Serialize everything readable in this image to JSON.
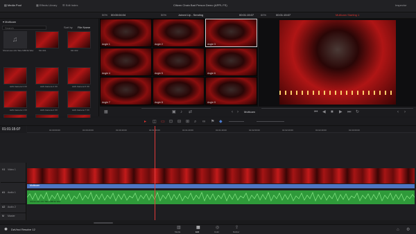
{
  "topbar": {
    "tabs": [
      {
        "label": "Media Pool"
      },
      {
        "label": "Effects Library"
      },
      {
        "label": "Edit Index"
      }
    ],
    "title": "Citizen Chain Bad Person Demo (APPL FS)",
    "right_label": "Inspector"
  },
  "header": {
    "left_fps": "50%",
    "left_tc": "00:00:04:04",
    "center_zoom": "50%",
    "clip_name": "Joined Up - Sending",
    "center_tc": "00:01:15:07",
    "right_zoom": "60%",
    "right_tc": "00:01:15:07",
    "status": "Multicam Starting 1"
  },
  "pool": {
    "bin": "Multicam",
    "search_placeholder": "Search",
    "sort": "Sort by",
    "sort_value": "File Name",
    "clips": [
      {
        "label": "Shownotes AAI Take MMOE Wav"
      },
      {
        "label": "MC 001"
      },
      {
        "label": "MC 002"
      },
      {
        "label": "MC 003"
      },
      {
        "label": "AAS Camera 3 XX"
      },
      {
        "label": "AAS Camera 4 XX"
      },
      {
        "label": "AAS Camera 5 XX"
      },
      {
        "label": "AAS Camera 6 XX"
      },
      {
        "label": "AAS Camera 1 XX"
      },
      {
        "label": "AAS Camera 2 XX"
      },
      {
        "label": "AAS Camera 7 XX"
      },
      {
        "label": "AAS Camera 8 XX"
      },
      {
        "label": "AAS Camera 9 XX"
      },
      {
        "label": "AAS Camera 10 XX"
      },
      {
        "label": "AAS Camera 11 XX"
      }
    ]
  },
  "multicam": {
    "angles": [
      {
        "label": "Angle 1"
      },
      {
        "label": "Angle 2"
      },
      {
        "label": "Angle 3"
      },
      {
        "label": "Angle 4"
      },
      {
        "label": "Angle 5"
      },
      {
        "label": "Angle 6"
      },
      {
        "label": "Angle 7"
      },
      {
        "label": "Angle 8"
      },
      {
        "label": "Angle 9"
      }
    ],
    "dropdown": "Multicam"
  },
  "timeline": {
    "timecode": "01:01:15:07",
    "ruler": [
      "01:00:00:00",
      "01:00:20:00",
      "01:00:40:00",
      "01:01:00:00",
      "01:01:20:00",
      "01:01:40:00",
      "01:02:00:00",
      "01:02:20:00",
      "01:02:40:00",
      "01:03:00:00"
    ],
    "tracks": [
      {
        "id": "V1",
        "name": "Video 1"
      },
      {
        "id": "A1",
        "name": "Audio 1"
      },
      {
        "id": "A2",
        "name": "Audio 2"
      },
      {
        "id": "M",
        "name": "Master"
      }
    ],
    "video_clip": "Multicam",
    "audio_clip": "Shownotes AAI Take MMOE Wav"
  },
  "bottom": {
    "app": "DaVinci Resolve 12",
    "pages": [
      {
        "label": "Media"
      },
      {
        "label": "Edit"
      },
      {
        "label": "Color"
      },
      {
        "label": "Deliver"
      }
    ]
  },
  "colors": {
    "accent": "#d9332f",
    "audio": "#2f9a3a",
    "video": "#a51414",
    "playhead": "#e23b3b"
  }
}
